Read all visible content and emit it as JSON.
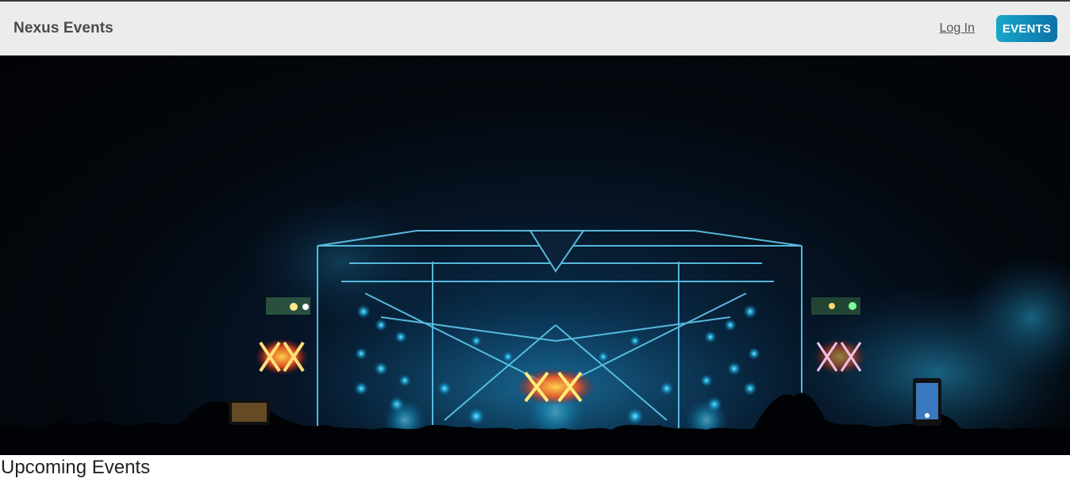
{
  "header": {
    "brand": "Nexus Events",
    "login_label": "Log In",
    "events_label": "EVENTS"
  },
  "hero": {
    "image": "concert-stage-photo"
  },
  "main": {
    "section_title": "Upcoming Events"
  },
  "colors": {
    "accent_start": "#1aa6c9",
    "accent_end": "#0a72a8",
    "navbar_bg": "#ececec"
  }
}
